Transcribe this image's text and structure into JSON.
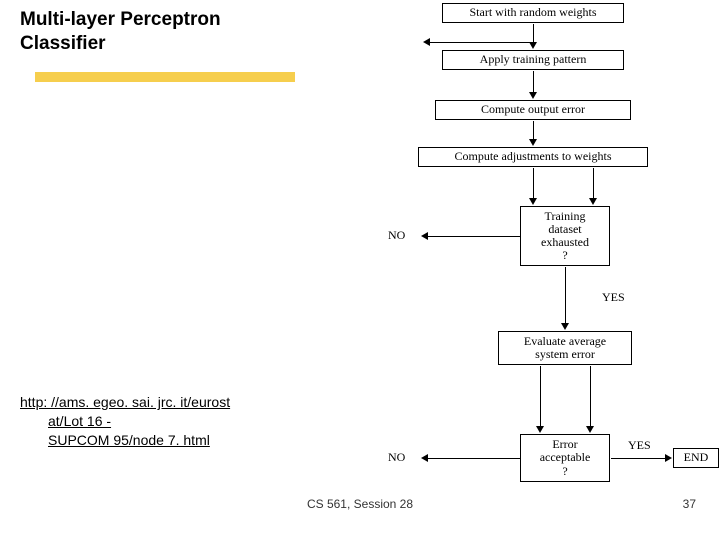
{
  "title_line1": "Multi-layer Perceptron",
  "title_line2": "Classifier",
  "url": {
    "line1": "http: //ams. egeo. sai. jrc. it/eurost",
    "line2": "at/Lot 16 -",
    "line3": "SUPCOM 95/node 7. html"
  },
  "footer": "CS 561,  Session 28",
  "page": "37",
  "flow": {
    "b1": "Start with random weights",
    "b2": "Apply training pattern",
    "b3": "Compute output error",
    "b4": "Compute adjustments to weights",
    "b5_l1": "Training",
    "b5_l2": "dataset",
    "b5_l3": "exhausted",
    "b5_l4": "?",
    "b6_l1": "Evaluate average",
    "b6_l2": "system error",
    "b7_l1": "Error",
    "b7_l2": "acceptable",
    "b7_l3": "?",
    "no": "NO",
    "yes": "YES",
    "end": "END"
  }
}
